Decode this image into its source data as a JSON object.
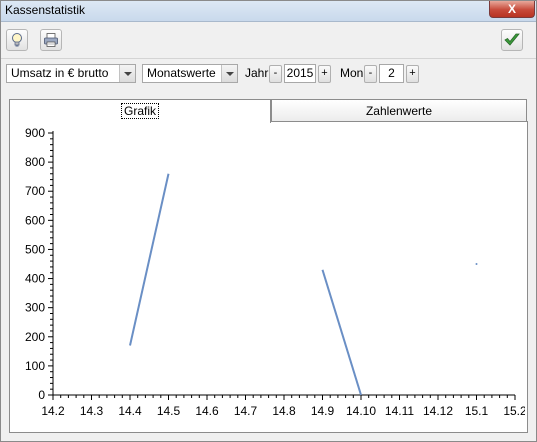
{
  "window": {
    "title": "Kassenstatistik",
    "close_label": "X"
  },
  "toolbar": {
    "buttons": [
      {
        "name": "hint-button",
        "icon": "lightbulb-icon"
      },
      {
        "name": "print-button",
        "icon": "printer-icon"
      }
    ],
    "confirm_icon": "checkmark-icon"
  },
  "controls": {
    "metric": "Umsatz in € brutto",
    "period_type": "Monatswerte",
    "year_label": "Jahr",
    "year_value": "2015",
    "month_label": "Mon",
    "month_value": "2",
    "minus": "-",
    "plus": "+"
  },
  "tabs": [
    {
      "label": "Grafik",
      "active": true
    },
    {
      "label": "Zahlenwerte",
      "active": false
    }
  ],
  "colors": {
    "line": "#6a8fc5",
    "accent": "#3a8a3a"
  },
  "chart_data": {
    "type": "line",
    "x_tick_labels": [
      "14.2",
      "14.3",
      "14.4",
      "14.5",
      "14.6",
      "14.7",
      "14.8",
      "14.9",
      "14.10",
      "14.11",
      "14.12",
      "15.1",
      "15.2"
    ],
    "y_ticks": [
      0,
      100,
      200,
      300,
      400,
      500,
      600,
      700,
      800,
      900
    ],
    "ylim": [
      0,
      900
    ],
    "grid": false,
    "segments": [
      {
        "x": [
          "14.4",
          "14.5"
        ],
        "y": [
          170,
          760
        ]
      },
      {
        "x": [
          "14.9",
          "14.10"
        ],
        "y": [
          430,
          0
        ]
      },
      {
        "x": [
          "15.1"
        ],
        "y": [
          450
        ]
      }
    ]
  }
}
